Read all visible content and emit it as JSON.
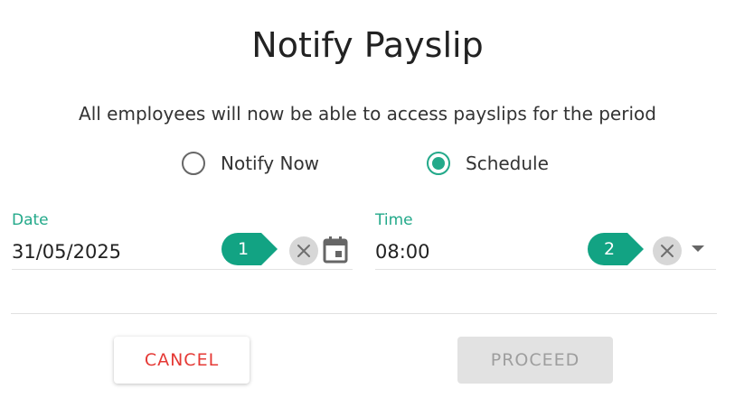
{
  "dialog": {
    "title": "Notify Payslip",
    "description": "All employees will now be able to access payslips for the period"
  },
  "notify_options": [
    {
      "label": "Notify Now",
      "selected": false
    },
    {
      "label": "Schedule",
      "selected": true
    }
  ],
  "date_field": {
    "label": "Date",
    "value": "31/05/2025",
    "icons": [
      "close-icon",
      "calendar-icon"
    ]
  },
  "time_field": {
    "label": "Time",
    "value": "08:00",
    "icons": [
      "close-icon",
      "dropdown-arrow-icon"
    ]
  },
  "callouts": [
    "1",
    "2"
  ],
  "actions": {
    "cancel_label": "CANCEL",
    "proceed_label": "PROCEED",
    "proceed_enabled": false
  },
  "colors": {
    "accent": "#23a98a",
    "callout": "#12a383",
    "cancel_text": "#e53935",
    "disabled_bg": "#e2e2e2"
  }
}
